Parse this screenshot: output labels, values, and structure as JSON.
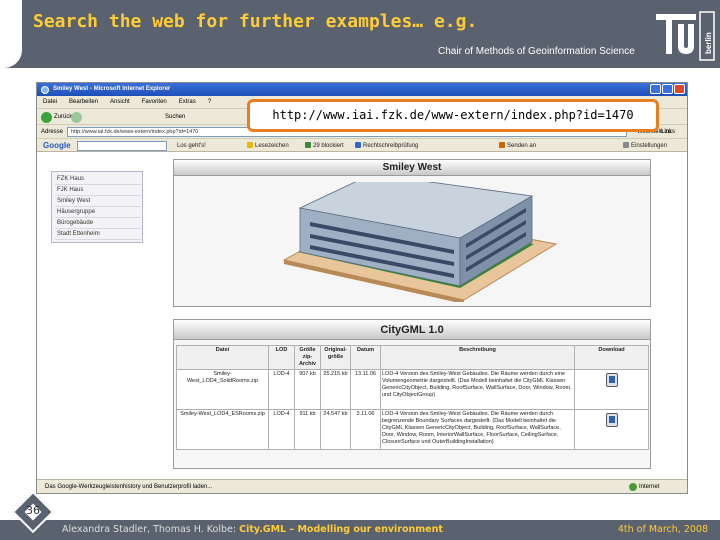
{
  "slide": {
    "title": "Search the web for further examples… e.g.",
    "chair": "Chair of Methods of Geoinformation Science",
    "logo_text": "TU",
    "logo_subtext": "berlin",
    "url_callout": "http://www.iai.fzk.de/www-extern/index.php?id=1470",
    "page_number": "36",
    "footer_authors": "Alexandra Stadler, Thomas H. Kolbe:",
    "footer_topic": "City.GML – Modelling our environment",
    "footer_date": "4th of March, 2008",
    "colors": {
      "header_bg": "#5a6270",
      "title_yellow": "#ffcc33",
      "callout_orange": "#e87f1e"
    }
  },
  "browser": {
    "window_title": "Smiley West - Microsoft Internet Explorer",
    "menu": [
      "Datei",
      "Bearbeiten",
      "Ansicht",
      "Favoriten",
      "Extras",
      "?"
    ],
    "toolbar": {
      "back": "Zurück",
      "search": "Suchen",
      "favorites": "Favoriten"
    },
    "address_label": "Adresse",
    "address_value": "http://www.iai.fzk.de/www-extern/index.php?id=1470",
    "go_label": "Wechseln zu",
    "links_label": "Links",
    "google": {
      "logo": "Google",
      "items": [
        "Los geht's!",
        "Lesezeichen",
        "29 blockiert",
        "Rechtschreibprüfung",
        "Senden an",
        "Einstellungen"
      ]
    },
    "nav_items": [
      "FZK Haus",
      "FJK Haus",
      "Smiley West",
      "Häusergruppe",
      "Bürogebäude",
      "Stadt Ettenheim"
    ],
    "smiley_panel_title": "Smiley West",
    "citygml_panel_title": "CityGML 1.0",
    "table": {
      "headers": [
        "Datei",
        "LOD",
        "Größe zip-Archiv",
        "Original-größe",
        "Datum",
        "Beschreibung",
        "Download"
      ],
      "rows": [
        {
          "file": "Smiley-West_LOD4_SolidRooms.zip",
          "lod": "LOD-4",
          "zip": "907 kb",
          "orig": "25.215 kb",
          "date": "13.11.06",
          "desc": "LOD-4 Version des Smiley-West Gebäudes. Die Räume werden durch eine Volumengeometrie dargestellt. (Das Modell beinhaltet die CityGML Klassen GenericCityObject, Building, RoofSurface, WallSurface, Door, Window, Room, und CityObjectGroup)"
        },
        {
          "file": "Smiley-West_LOD4_ESRooms.zip",
          "lod": "LOD-4",
          "zip": "911 kb",
          "orig": "24.547 kb",
          "date": "3.11.06",
          "desc": "LOD-4 Version des Smiley-West Gebäudes. Die Räume werden durch begrenzende Boundary Surfaces dargestellt. (Das Modell beinhaltet die CityGML Klassen GenericCityObject, Building, RoofSurface, WallSurface, Door, Window, Room, InteriorWallSurface, FloorSurface, CeilingSurface, ClosureSurface und OuterBuildingInstallation)"
        }
      ]
    },
    "status_text": "Das Google-Werkzeugleistenhistory und Benutzerprofil laden...",
    "zone_text": "Internet"
  }
}
